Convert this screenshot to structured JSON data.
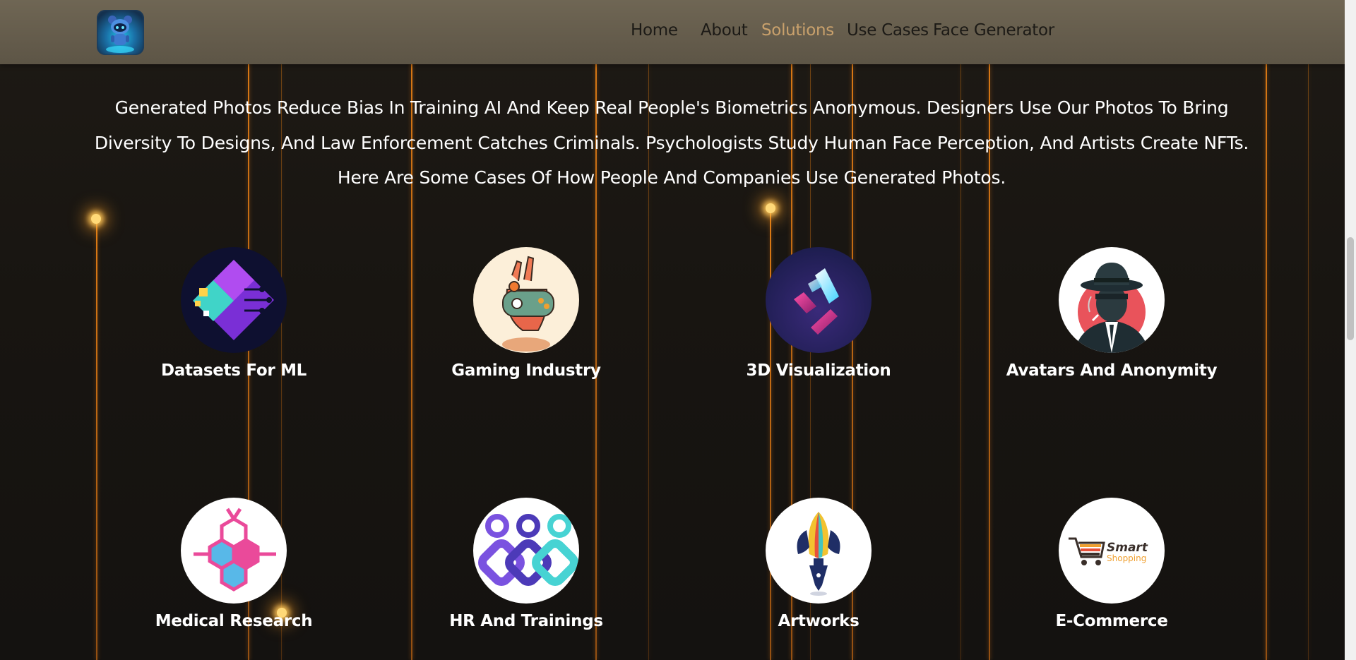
{
  "brand": {
    "logo_icon": "robot-mascot-icon"
  },
  "nav": {
    "items": [
      {
        "label": "Home",
        "active": false
      },
      {
        "label": "About",
        "active": false
      },
      {
        "label": "Solutions",
        "active": true
      },
      {
        "label": "Use Cases",
        "active": false
      },
      {
        "label": "Face Generator",
        "active": false
      }
    ]
  },
  "intro": {
    "line1": "Generated Photos Reduce Bias In Training AI And Keep Real People's Biometrics Anonymous. Designers Use Our Photos To Bring",
    "line2": "Diversity To Designs, And Law Enforcement Catches Criminals. Psychologists Study Human Face Perception, And Artists Create NFTs.",
    "line3": "Here Are Some Cases Of How People And Companies Use Generated Photos."
  },
  "cases": [
    {
      "label": "Datasets For ML",
      "icon": "circuit-diamond-icon"
    },
    {
      "label": "Gaming Industry",
      "icon": "game-controller-hand-icon"
    },
    {
      "label": "3D Visualization",
      "icon": "3d-bars-icon"
    },
    {
      "label": "Avatars And Anonymity",
      "icon": "spy-man-icon"
    },
    {
      "label": "Medical Research",
      "icon": "molecule-hexagon-icon"
    },
    {
      "label": "HR And Trainings",
      "icon": "linked-people-icon"
    },
    {
      "label": "Artworks",
      "icon": "feather-pen-icon"
    },
    {
      "label": "E-Commerce",
      "icon": "shopping-cart-logo"
    }
  ],
  "ecommerce_logo_text": {
    "line1": "Smart",
    "line2": "Shopping"
  },
  "colors": {
    "background": "#171410",
    "header": "#665e4e",
    "accent_line": "#e08018",
    "nav_active": "#c9a16c",
    "text": "#ffffff"
  }
}
